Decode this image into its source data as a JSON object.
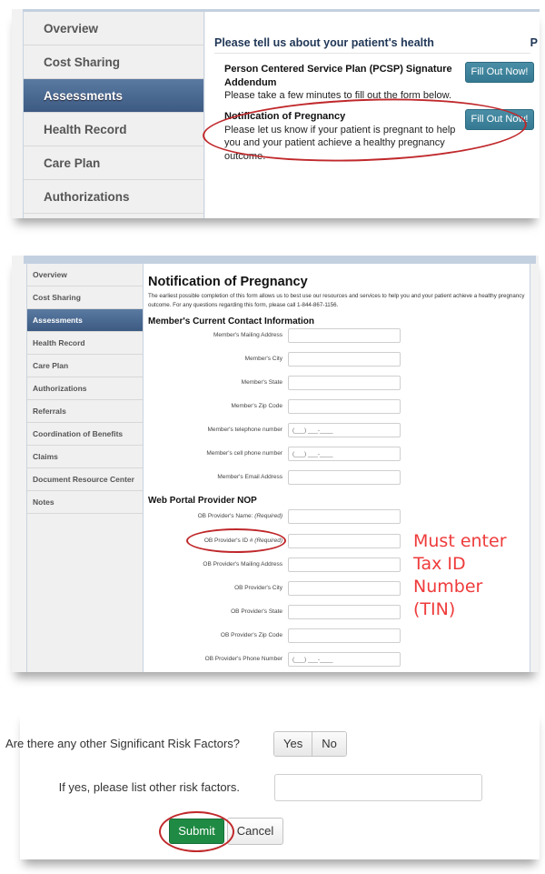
{
  "sidebar_primary": {
    "items": [
      {
        "label": "Overview",
        "active": false
      },
      {
        "label": "Cost Sharing",
        "active": false
      },
      {
        "label": "Assessments",
        "active": true
      },
      {
        "label": "Health Record",
        "active": false
      },
      {
        "label": "Care Plan",
        "active": false
      },
      {
        "label": "Authorizations",
        "active": false
      }
    ]
  },
  "assessments": {
    "heading": "Please tell us about your patient's health",
    "heading_cutoff": "P",
    "entries": [
      {
        "title": "Person Centered Service Plan (PCSP) Signature Addendum",
        "description": "Please take a few minutes to fill out the form below.",
        "button_label": "Fill Out Now!"
      },
      {
        "title": "Notification of Pregnancy",
        "description": "Please let us know if your patient is pregnant to help you and your patient achieve a healthy pregnancy outcome.",
        "button_label": "Fill Out Now!"
      }
    ]
  },
  "sidebar_secondary": {
    "items": [
      {
        "label": "Overview"
      },
      {
        "label": "Cost Sharing"
      },
      {
        "label": "Assessments"
      },
      {
        "label": "Health Record"
      },
      {
        "label": "Care Plan"
      },
      {
        "label": "Authorizations"
      },
      {
        "label": "Referrals"
      },
      {
        "label": "Coordination of Benefits"
      },
      {
        "label": "Claims"
      },
      {
        "label": "Document Resource Center"
      },
      {
        "label": "Notes"
      }
    ]
  },
  "nop_form": {
    "title": "Notification of Pregnancy",
    "intro": "The earliest possible completion of this form allows us to best use our resources and services to help you and your patient achieve a healthy pregnancy outcome. For any questions regarding this form, please call 1-844-867-1156.",
    "member_section": {
      "heading": "Member's Current Contact Information",
      "fields": [
        {
          "label": "Member's Mailing Address",
          "value": ""
        },
        {
          "label": "Member's City",
          "value": ""
        },
        {
          "label": "Member's State",
          "value": ""
        },
        {
          "label": "Member's Zip Code",
          "value": ""
        },
        {
          "label": "Member's telephone number",
          "value": "(___) ___-____"
        },
        {
          "label": "Member's cell phone number",
          "value": "(___) ___-____"
        },
        {
          "label": "Member's Email Address",
          "value": ""
        }
      ]
    },
    "provider_section": {
      "heading": "Web Portal Provider NOP",
      "fields": [
        {
          "label": "OB Provider's Name:",
          "suffix": "(Required)",
          "value": ""
        },
        {
          "label": "OB Provider's ID #",
          "suffix": "(Required)",
          "value": ""
        },
        {
          "label": "OB Provider's Mailing Address",
          "suffix": "",
          "value": ""
        },
        {
          "label": "OB Provider's City",
          "suffix": "",
          "value": ""
        },
        {
          "label": "OB Provider's State",
          "suffix": "",
          "value": ""
        },
        {
          "label": "OB Provider's Zip Code",
          "suffix": "",
          "value": ""
        },
        {
          "label": "OB Provider's Phone Number",
          "suffix": "",
          "value": "(___) ___-____"
        }
      ]
    }
  },
  "annotation": {
    "note_lines": [
      "Must enter",
      "Tax ID",
      "Number",
      "(TIN)"
    ],
    "color": "#ef3b3b",
    "circle_color": "#c0282b"
  },
  "risk": {
    "question": "Are there any other Significant Risk Factors?",
    "yes_label": "Yes",
    "no_label": "No",
    "list_label": "If yes, please list other risk factors.",
    "list_value": "",
    "submit_label": "Submit",
    "cancel_label": "Cancel"
  },
  "colors": {
    "nav_active": "#3c5a82",
    "fill_button": "#3d8199",
    "submit_button": "#1f8a43",
    "heading": "#1f3656"
  }
}
